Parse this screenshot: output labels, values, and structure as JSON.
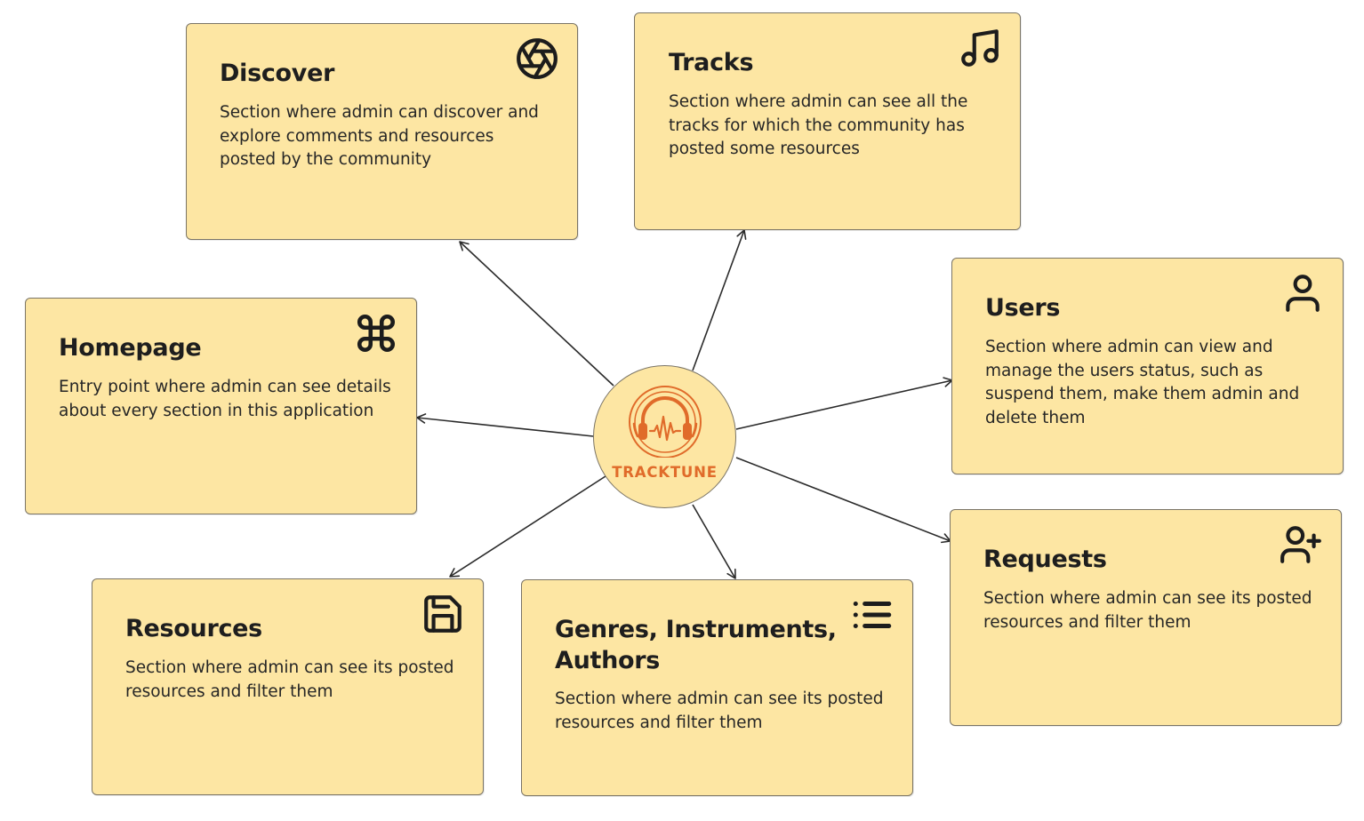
{
  "hub": {
    "name": "TRACKTUNE",
    "accent_color": "#e06b2a",
    "icon": "headphones-waveform-logo"
  },
  "colors": {
    "card_fill": "#fde6a3",
    "card_border": "#7a7466",
    "arrow": "#2b2b2b"
  },
  "cards": {
    "discover": {
      "title": "Discover",
      "description": "Section where admin can discover and explore comments and resources posted by the community",
      "icon": "aperture-icon"
    },
    "tracks": {
      "title": "Tracks",
      "description": "Section where admin can see all the tracks for which the community has posted some resources",
      "icon": "music-note-icon"
    },
    "homepage": {
      "title": "Homepage",
      "description": "Entry point where admin can see details about every section in this application",
      "icon": "command-icon"
    },
    "users": {
      "title": "Users",
      "description": "Section where admin can view and manage the users status, such as suspend them, make them admin and delete them",
      "icon": "user-icon"
    },
    "requests": {
      "title": "Requests",
      "description": "Section where admin can see its posted resources and filter them",
      "icon": "user-plus-icon"
    },
    "resources": {
      "title": "Resources",
      "description": "Section where admin can see its posted resources and filter them",
      "icon": "save-icon"
    },
    "genres": {
      "title": "Genres, Instruments, Authors",
      "description": "Section where admin can see its posted resources and filter them",
      "icon": "list-icon"
    }
  },
  "edges": [
    {
      "from": "hub",
      "to": "discover"
    },
    {
      "from": "hub",
      "to": "tracks"
    },
    {
      "from": "hub",
      "to": "homepage"
    },
    {
      "from": "hub",
      "to": "users"
    },
    {
      "from": "hub",
      "to": "requests"
    },
    {
      "from": "hub",
      "to": "resources"
    },
    {
      "from": "hub",
      "to": "genres"
    }
  ]
}
